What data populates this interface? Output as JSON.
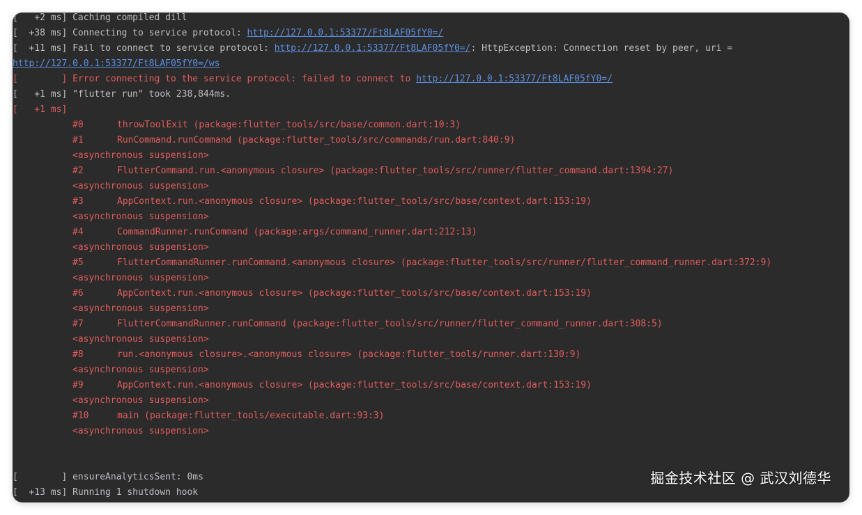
{
  "log": {
    "l1_prefix": "[   +2 ms] ",
    "l1_text": "Caching compiled dill",
    "l2_prefix": "[  +38 ms] ",
    "l2_text": "Connecting to service protocol: ",
    "l2_link": "http://127.0.0.1:53377/Ft8LAF05fY0=/",
    "l3_prefix": "[  +11 ms] ",
    "l3_text": "Fail to connect to service protocol: ",
    "l3_link": "http://127.0.0.1:53377/Ft8LAF05fY0=/",
    "l3_suffix": ": HttpException: Connection reset by peer, uri =",
    "l4_link": "http://127.0.0.1:53377/Ft8LAF05fY0=/ws",
    "l5_prefix": "[        ] ",
    "l5_text": "Error connecting to the service protocol: failed to connect to ",
    "l5_link": "http://127.0.0.1:53377/Ft8LAF05fY0=/",
    "l6_prefix": "[   +1 ms] ",
    "l6_text": "\"flutter run\" took 238,844ms.",
    "l7_prefix": "[   +1 ms]",
    "trace": [
      {
        "num": "#0",
        "frame": "throwToolExit (package:flutter_tools/src/base/common.dart:10:3)"
      },
      {
        "num": "#1",
        "frame": "RunCommand.runCommand (package:flutter_tools/src/commands/run.dart:840:9)"
      },
      {
        "num": "#2",
        "frame": "FlutterCommand.run.<anonymous closure> (package:flutter_tools/src/runner/flutter_command.dart:1394:27)"
      },
      {
        "num": "#3",
        "frame": "AppContext.run.<anonymous closure> (package:flutter_tools/src/base/context.dart:153:19)"
      },
      {
        "num": "#4",
        "frame": "CommandRunner.runCommand (package:args/command_runner.dart:212:13)"
      },
      {
        "num": "#5",
        "frame": "FlutterCommandRunner.runCommand.<anonymous closure> (package:flutter_tools/src/runner/flutter_command_runner.dart:372:9)"
      },
      {
        "num": "#6",
        "frame": "AppContext.run.<anonymous closure> (package:flutter_tools/src/base/context.dart:153:19)"
      },
      {
        "num": "#7",
        "frame": "FlutterCommandRunner.runCommand (package:flutter_tools/src/runner/flutter_command_runner.dart:308:5)"
      },
      {
        "num": "#8",
        "frame": "run.<anonymous closure>.<anonymous closure> (package:flutter_tools/runner.dart:130:9)"
      },
      {
        "num": "#9",
        "frame": "AppContext.run.<anonymous closure> (package:flutter_tools/src/base/context.dart:153:19)"
      },
      {
        "num": "#10",
        "frame": "main (package:flutter_tools/executable.dart:93:3)"
      }
    ],
    "async_suspension": "<asynchronous suspension>",
    "l_end1_prefix": "[        ] ",
    "l_end1_text": "ensureAnalyticsSent: 0ms",
    "l_end2_prefix": "[  +13 ms] ",
    "l_end2_text": "Running 1 shutdown hook"
  },
  "watermark": "掘金技术社区 @ 武汉刘德华",
  "colors": {
    "background": "#2b2b2b",
    "text": "#bcbec4",
    "error": "#e05c5c",
    "link": "#5c8fe0"
  }
}
